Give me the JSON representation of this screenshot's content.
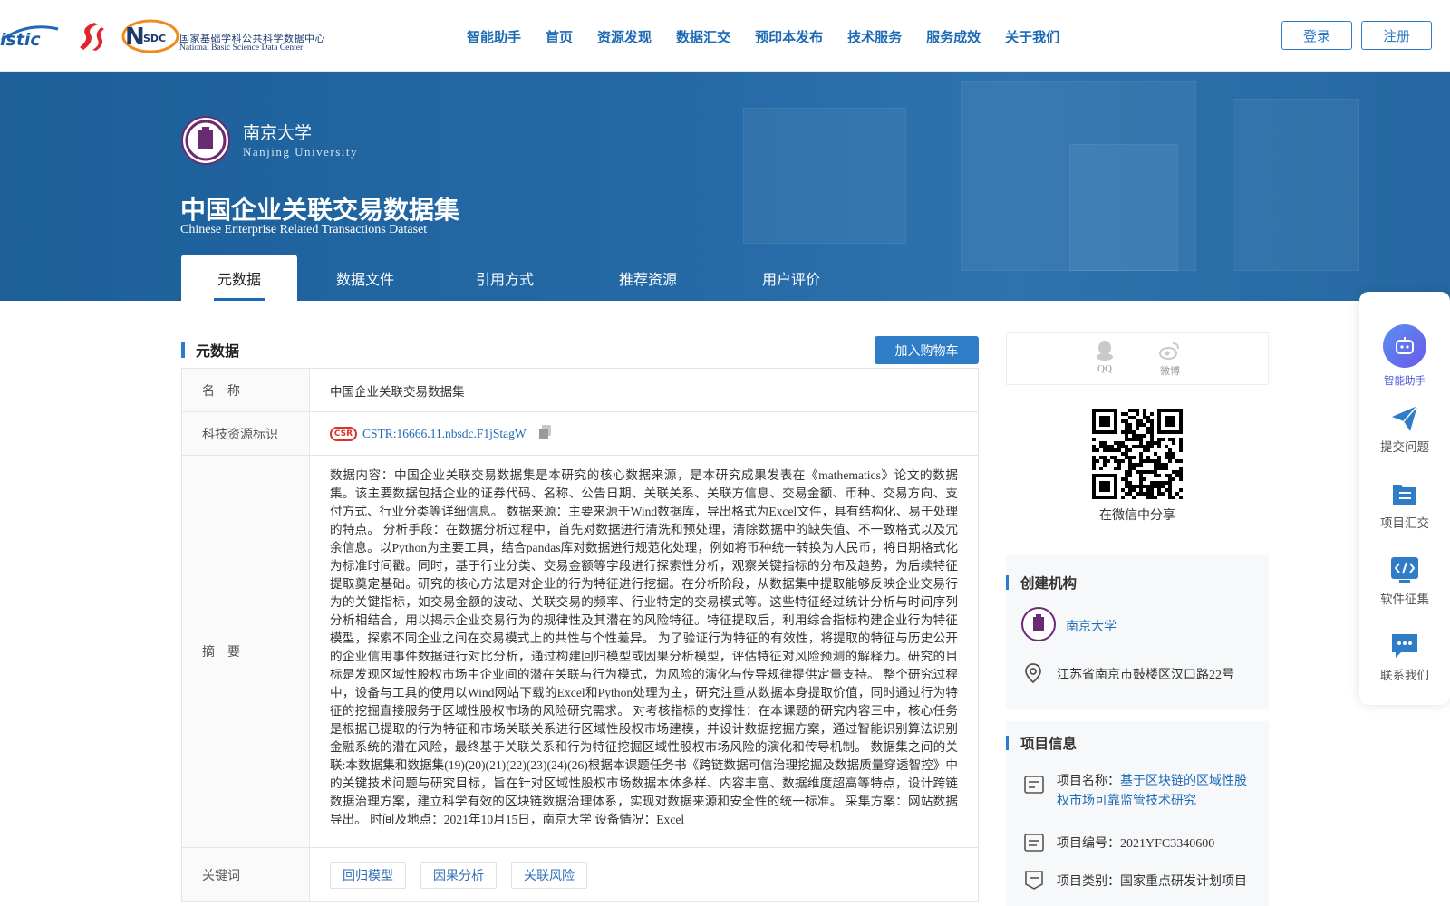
{
  "header": {
    "logo_nsdc_cn": "国家基础学科公共科学数据中心",
    "logo_nsdc_en": "National Basic Science Data Center",
    "logo_nsdc_mark": "SDC",
    "logo_istic_text": "istic",
    "nav": [
      "智能助手",
      "首页",
      "资源发现",
      "数据汇交",
      "预印本发布",
      "技术服务",
      "服务成效",
      "关于我们"
    ],
    "login": "登录",
    "register": "注册"
  },
  "hero": {
    "institution_cn": "南京大学",
    "institution_en": "Nanjing University",
    "title_cn": "中国企业关联交易数据集",
    "title_en": "Chinese Enterprise Related Transactions Dataset",
    "tabs": [
      "元数据",
      "数据文件",
      "引用方式",
      "推荐资源",
      "用户评价"
    ],
    "active_tab": 0
  },
  "metadata": {
    "section_title": "元数据",
    "cart_button": "加入购物车",
    "rows": {
      "name_label": "名　称",
      "name_value": "中国企业关联交易数据集",
      "id_label": "科技资源标识",
      "cstr_logo": "CSR",
      "cstr_value": "CSTR:16666.11.nbsdc.F1jStagW",
      "abstract_label": "摘　要",
      "abstract_value": "数据内容：中国企业关联交易数据集是本研究的核心数据来源，是本研究成果发表在《mathematics》论文的数据集。该主要数据包括企业的证券代码、名称、公告日期、关联关系、关联方信息、交易金额、币种、交易方向、支付方式、行业分类等详细信息。 数据来源：主要来源于Wind数据库，导出格式为Excel文件，具有结构化、易于处理的特点。 分析手段：在数据分析过程中，首先对数据进行清洗和预处理，清除数据中的缺失值、不一致格式以及冗余信息。以Python为主要工具，结合pandas库对数据进行规范化处理，例如将币种统一转换为人民币，将日期格式化为标准时间戳。同时，基于行业分类、交易金额等字段进行探索性分析，观察关键指标的分布及趋势，为后续特征提取奠定基础。研究的核心方法是对企业的行为特征进行挖掘。在分析阶段，从数据集中提取能够反映企业交易行为的关键指标，如交易金额的波动、关联交易的频率、行业特定的交易模式等。这些特征经过统计分析与时间序列分析相结合，用以揭示企业交易行为的规律性及其潜在的风险特征。特征提取后，利用综合指标构建企业行为特征模型，探索不同企业之间在交易模式上的共性与个性差异。 为了验证行为特征的有效性，将提取的特征与历史公开的企业信用事件数据进行对比分析，通过构建回归模型或因果分析模型，评估特征对风险预测的解释力。研究的目标是发现区域性股权市场中企业间的潜在关联与行为模式，为风险的演化与传导规律提供定量支持。 整个研究过程中，设备与工具的使用以Wind网站下载的Excel和Python处理为主，研究注重从数据本身提取价值，同时通过行为特征的挖掘直接服务于区域性股权市场的风险研究需求。 对考核指标的支撑性：在本课题的研究内容三中，核心任务是根据已提取的行为特征和市场关联关系进行区域性股权市场建模，并设计数据挖掘方案，通过智能识别算法识别金融系统的潜在风险，最终基于关联关系和行为特征挖掘区域性股权市场风险的演化和传导机制。 数据集之间的关联:本数据集和数据集(19)(20)(21)(22)(23)(24)(26)根据本课题任务书《跨链数据可信治理挖掘及数据质量穿透智控》中的关键技术问题与研究目标，旨在针对区域性股权市场数据本体多样、内容丰富、数据维度超高等特点，设计跨链数据治理方案，建立科学有效的区块链数据治理体系，实现对数据来源和安全性的统一标准。 采集方案：网站数据导出。 时间及地点：2021年10月15日，南京大学 设备情况：Excel",
      "keywords_label": "关键词",
      "keywords": [
        "回归模型",
        "因果分析",
        "关联风险"
      ]
    }
  },
  "share": {
    "qq": "QQ",
    "weibo": "微博",
    "wechat_caption": "在微信中分享"
  },
  "institution_card": {
    "title": "创建机构",
    "name": "南京大学",
    "address": "江苏省南京市鼓楼区汉口路22号"
  },
  "project_card": {
    "title": "项目信息",
    "name_label": "项目名称：",
    "name_value": "基于区块链的区域性股权市场可靠监管技术研究",
    "code_label": "项目编号：",
    "code_value": "2021YFC3340600",
    "type_label": "项目类别：",
    "type_value": "国家重点研发计划项目"
  },
  "float_panel": {
    "assistant": "智能助手",
    "submit": "提交问题",
    "projects": "项目汇交",
    "software": "软件征集",
    "contact": "联系我们"
  },
  "colors": {
    "primary": "#2f7cc7",
    "nav": "#1c6ab5",
    "hero": "#2469a6",
    "university": "#6a2c70"
  }
}
